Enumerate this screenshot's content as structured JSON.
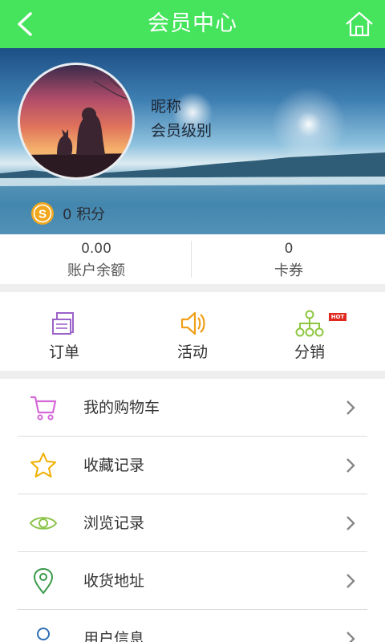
{
  "header": {
    "title": "会员中心",
    "back_icon": "back-arrow-icon",
    "home_icon": "home-icon",
    "color": "#45e45c"
  },
  "profile": {
    "nickname": "昵称",
    "level": "会员级别",
    "points_value": "0",
    "points_label": "积分",
    "coin_icon": "coin-icon"
  },
  "stats": [
    {
      "value": "0.00",
      "label": "账户余额"
    },
    {
      "value": "0",
      "label": "卡券"
    }
  ],
  "quick_links": [
    {
      "label": "订单",
      "icon": "order-icon",
      "color": "#9b62c8"
    },
    {
      "label": "活动",
      "icon": "speaker-icon",
      "color": "#f0a01a"
    },
    {
      "label": "分销",
      "icon": "distribution-icon",
      "color": "#8dc63f",
      "badge": "HOT"
    }
  ],
  "menu": [
    {
      "label": "我的购物车",
      "icon": "cart-icon",
      "color": "#d46ad8"
    },
    {
      "label": "收藏记录",
      "icon": "star-icon",
      "color": "#f0b000"
    },
    {
      "label": "浏览记录",
      "icon": "eye-icon",
      "color": "#8bc34a"
    },
    {
      "label": "收货地址",
      "icon": "location-pin-icon",
      "color": "#3a9a4a"
    },
    {
      "label": "用户信息",
      "icon": "user-icon",
      "color": "#2f6fb8"
    }
  ]
}
